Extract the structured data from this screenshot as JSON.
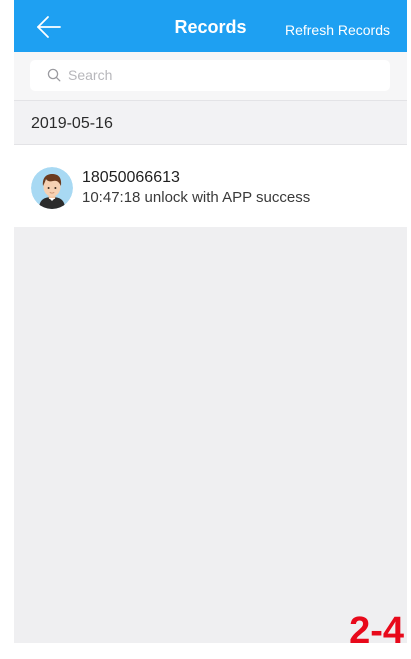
{
  "header": {
    "back_icon": "arrow-left-icon",
    "title": "Records",
    "refresh_label": "Refresh Records"
  },
  "search": {
    "icon": "search-icon",
    "placeholder": "Search",
    "value": ""
  },
  "records": {
    "date": "2019-05-16",
    "items": [
      {
        "avatar": "user-avatar",
        "user": "18050066613",
        "detail": "10:47:18 unlock with APP success"
      }
    ]
  },
  "figure_label": "2-4",
  "colors": {
    "accent": "#1ea0f2",
    "background": "#efeff1",
    "label": "#e8091b"
  }
}
